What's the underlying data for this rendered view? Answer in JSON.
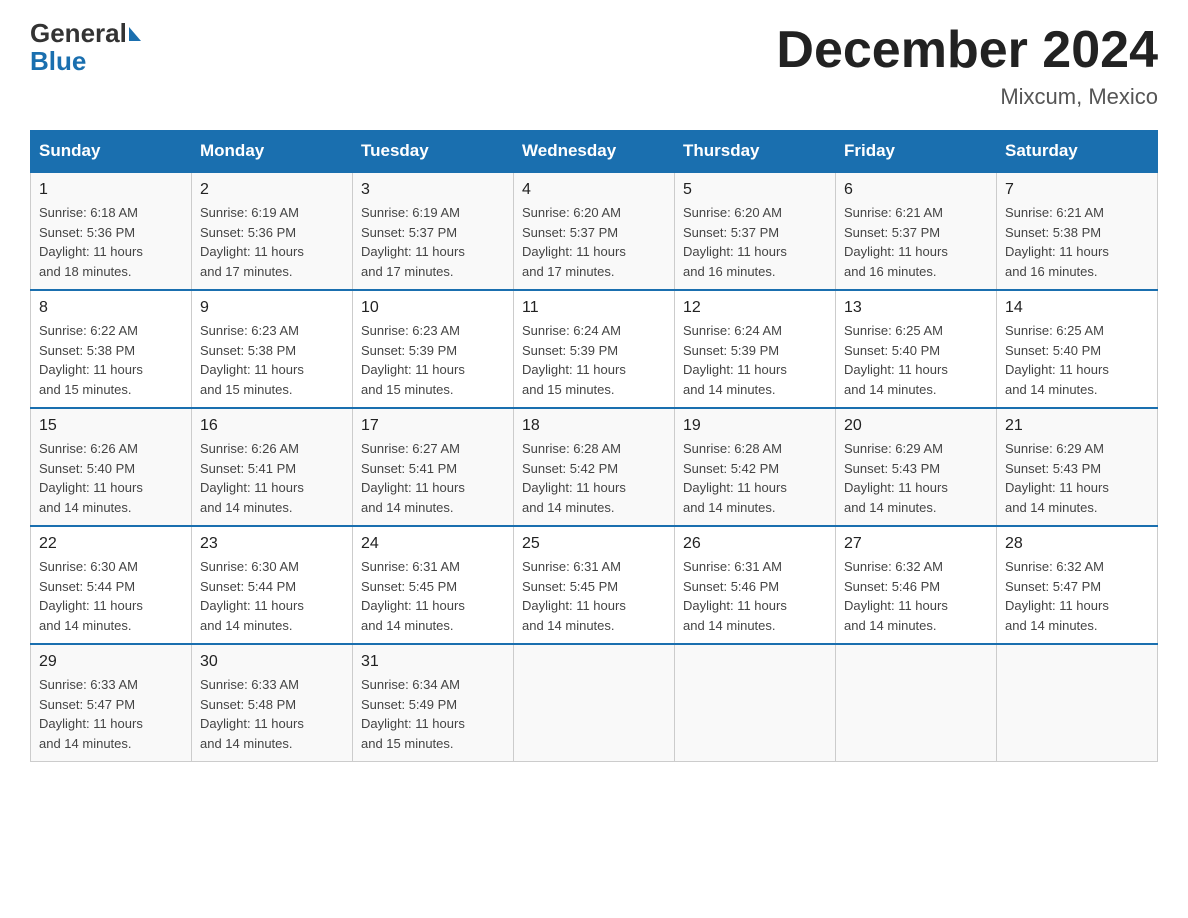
{
  "header": {
    "logo_general": "General",
    "logo_blue": "Blue",
    "month_title": "December 2024",
    "location": "Mixcum, Mexico"
  },
  "days_of_week": [
    "Sunday",
    "Monday",
    "Tuesday",
    "Wednesday",
    "Thursday",
    "Friday",
    "Saturday"
  ],
  "weeks": [
    [
      {
        "day": "1",
        "sunrise": "6:18 AM",
        "sunset": "5:36 PM",
        "daylight": "11 hours and 18 minutes."
      },
      {
        "day": "2",
        "sunrise": "6:19 AM",
        "sunset": "5:36 PM",
        "daylight": "11 hours and 17 minutes."
      },
      {
        "day": "3",
        "sunrise": "6:19 AM",
        "sunset": "5:37 PM",
        "daylight": "11 hours and 17 minutes."
      },
      {
        "day": "4",
        "sunrise": "6:20 AM",
        "sunset": "5:37 PM",
        "daylight": "11 hours and 17 minutes."
      },
      {
        "day": "5",
        "sunrise": "6:20 AM",
        "sunset": "5:37 PM",
        "daylight": "11 hours and 16 minutes."
      },
      {
        "day": "6",
        "sunrise": "6:21 AM",
        "sunset": "5:37 PM",
        "daylight": "11 hours and 16 minutes."
      },
      {
        "day": "7",
        "sunrise": "6:21 AM",
        "sunset": "5:38 PM",
        "daylight": "11 hours and 16 minutes."
      }
    ],
    [
      {
        "day": "8",
        "sunrise": "6:22 AM",
        "sunset": "5:38 PM",
        "daylight": "11 hours and 15 minutes."
      },
      {
        "day": "9",
        "sunrise": "6:23 AM",
        "sunset": "5:38 PM",
        "daylight": "11 hours and 15 minutes."
      },
      {
        "day": "10",
        "sunrise": "6:23 AM",
        "sunset": "5:39 PM",
        "daylight": "11 hours and 15 minutes."
      },
      {
        "day": "11",
        "sunrise": "6:24 AM",
        "sunset": "5:39 PM",
        "daylight": "11 hours and 15 minutes."
      },
      {
        "day": "12",
        "sunrise": "6:24 AM",
        "sunset": "5:39 PM",
        "daylight": "11 hours and 14 minutes."
      },
      {
        "day": "13",
        "sunrise": "6:25 AM",
        "sunset": "5:40 PM",
        "daylight": "11 hours and 14 minutes."
      },
      {
        "day": "14",
        "sunrise": "6:25 AM",
        "sunset": "5:40 PM",
        "daylight": "11 hours and 14 minutes."
      }
    ],
    [
      {
        "day": "15",
        "sunrise": "6:26 AM",
        "sunset": "5:40 PM",
        "daylight": "11 hours and 14 minutes."
      },
      {
        "day": "16",
        "sunrise": "6:26 AM",
        "sunset": "5:41 PM",
        "daylight": "11 hours and 14 minutes."
      },
      {
        "day": "17",
        "sunrise": "6:27 AM",
        "sunset": "5:41 PM",
        "daylight": "11 hours and 14 minutes."
      },
      {
        "day": "18",
        "sunrise": "6:28 AM",
        "sunset": "5:42 PM",
        "daylight": "11 hours and 14 minutes."
      },
      {
        "day": "19",
        "sunrise": "6:28 AM",
        "sunset": "5:42 PM",
        "daylight": "11 hours and 14 minutes."
      },
      {
        "day": "20",
        "sunrise": "6:29 AM",
        "sunset": "5:43 PM",
        "daylight": "11 hours and 14 minutes."
      },
      {
        "day": "21",
        "sunrise": "6:29 AM",
        "sunset": "5:43 PM",
        "daylight": "11 hours and 14 minutes."
      }
    ],
    [
      {
        "day": "22",
        "sunrise": "6:30 AM",
        "sunset": "5:44 PM",
        "daylight": "11 hours and 14 minutes."
      },
      {
        "day": "23",
        "sunrise": "6:30 AM",
        "sunset": "5:44 PM",
        "daylight": "11 hours and 14 minutes."
      },
      {
        "day": "24",
        "sunrise": "6:31 AM",
        "sunset": "5:45 PM",
        "daylight": "11 hours and 14 minutes."
      },
      {
        "day": "25",
        "sunrise": "6:31 AM",
        "sunset": "5:45 PM",
        "daylight": "11 hours and 14 minutes."
      },
      {
        "day": "26",
        "sunrise": "6:31 AM",
        "sunset": "5:46 PM",
        "daylight": "11 hours and 14 minutes."
      },
      {
        "day": "27",
        "sunrise": "6:32 AM",
        "sunset": "5:46 PM",
        "daylight": "11 hours and 14 minutes."
      },
      {
        "day": "28",
        "sunrise": "6:32 AM",
        "sunset": "5:47 PM",
        "daylight": "11 hours and 14 minutes."
      }
    ],
    [
      {
        "day": "29",
        "sunrise": "6:33 AM",
        "sunset": "5:47 PM",
        "daylight": "11 hours and 14 minutes."
      },
      {
        "day": "30",
        "sunrise": "6:33 AM",
        "sunset": "5:48 PM",
        "daylight": "11 hours and 14 minutes."
      },
      {
        "day": "31",
        "sunrise": "6:34 AM",
        "sunset": "5:49 PM",
        "daylight": "11 hours and 15 minutes."
      },
      null,
      null,
      null,
      null
    ]
  ],
  "labels": {
    "sunrise": "Sunrise:",
    "sunset": "Sunset:",
    "daylight": "Daylight:"
  }
}
